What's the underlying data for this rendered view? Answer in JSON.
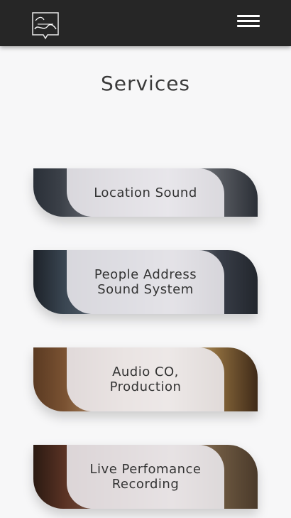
{
  "header": {
    "logo_icon": "audio-sound-logo-icon",
    "menu_icon": "hamburger-menu-icon"
  },
  "page": {
    "title": "Services"
  },
  "services": [
    {
      "label": "Location Sound"
    },
    {
      "label": "People Address\nSound System"
    },
    {
      "label": "Audio CO,\nProduction"
    },
    {
      "label": "Live Perfomance\nRecording"
    }
  ]
}
